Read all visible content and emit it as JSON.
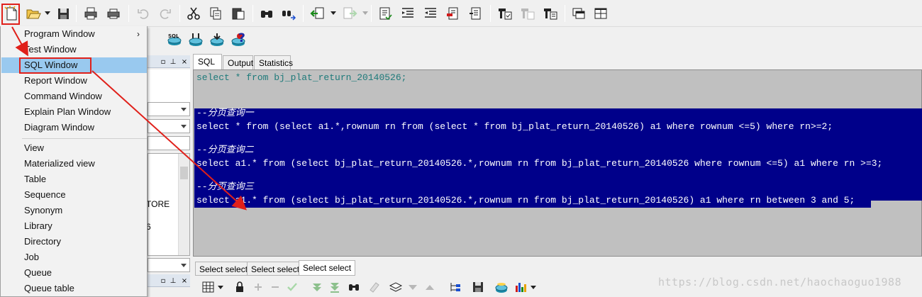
{
  "popup_menu": {
    "items": [
      {
        "label": "Program Window",
        "submenu": true
      },
      {
        "label": "Test Window"
      },
      {
        "label": "SQL Window",
        "highlighted": true
      },
      {
        "label": "Report Window"
      },
      {
        "label": "Command Window"
      },
      {
        "label": "Explain Plan Window"
      },
      {
        "label": "Diagram Window"
      },
      {
        "label": "View"
      },
      {
        "label": "Materialized view"
      },
      {
        "label": "Table"
      },
      {
        "label": "Sequence"
      },
      {
        "label": "Synonym"
      },
      {
        "label": "Library"
      },
      {
        "label": "Directory"
      },
      {
        "label": "Job"
      },
      {
        "label": "Queue"
      },
      {
        "label": "Queue table"
      }
    ],
    "submenu_glyph": "›"
  },
  "editor": {
    "tabs": [
      "SQL",
      "Output",
      "Statistics"
    ],
    "active_tab": "SQL",
    "lines": [
      "select * from bj_plat_return_20140526;",
      "--分页查询一",
      "select * from (select a1.*,rownum rn from (select * from bj_plat_return_20140526) a1 where rownum <=5) where rn>=2;",
      "--分页查询二",
      "select a1.* from (select bj_plat_return_20140526.*,rownum rn from bj_plat_return_20140526 where rownum <=5) a1 where rn >=3;",
      "--分页查询三",
      "select a1.* from (select bj_plat_return_20140526.*,rownum rn from bj_plat_return_20140526) a1 where rn between 3 and 5;"
    ],
    "selection_color": "#00008a",
    "background_color": "#c0c0c0"
  },
  "result_tabs": [
    "Select select",
    "Select select",
    "Select select"
  ],
  "left_panel": {
    "fragments": [
      "TORE",
      "6"
    ]
  },
  "toolbar2": {
    "help_glyph": "?"
  },
  "watermark": "https://blog.csdn.net/haochaoguo1988",
  "icons": {
    "toolbar1": [
      "new-icon",
      "open-icon",
      "save-icon",
      "print-icon",
      "print-setup-icon",
      "undo-icon",
      "redo-icon",
      "cut-icon",
      "copy-icon",
      "paste-icon",
      "find-icon",
      "replace-icon",
      "back-icon",
      "forward-icon",
      "document-icon",
      "indent-icon",
      "unindent-icon",
      "comment-icon",
      "uncomment-icon",
      "compile-icon",
      "debug-icon",
      "execute-icon",
      "windows-icon",
      "tile-icon"
    ],
    "toolbar3": [
      "grid-icon",
      "lock-icon",
      "plus-icon",
      "minus-icon",
      "check-icon",
      "down-icon",
      "down-all-icon",
      "find-icon",
      "clear-icon",
      "stack-icon",
      "arrow-down-icon",
      "arrow-up-icon",
      "tree-icon",
      "save-icon",
      "db-icon",
      "chart-icon"
    ]
  },
  "colors": {
    "highlight_box": "#e0201a",
    "menu_highlight": "#99c9ef",
    "arrow": "#e0201a"
  }
}
